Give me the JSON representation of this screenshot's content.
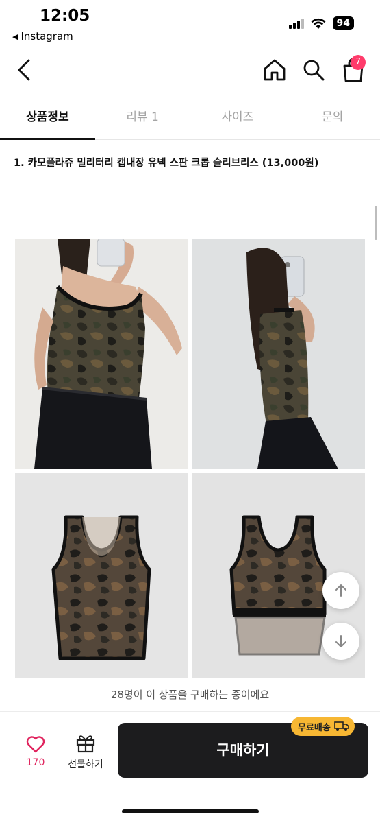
{
  "status_bar": {
    "time": "12:05",
    "back_app": "Instagram",
    "battery": "94"
  },
  "nav": {
    "cart_count": "7"
  },
  "tabs": [
    {
      "label": "상품정보",
      "active": true
    },
    {
      "label": "리뷰 1",
      "active": false
    },
    {
      "label": "사이즈",
      "active": false
    },
    {
      "label": "문의",
      "active": false
    }
  ],
  "product": {
    "title": "1. 카모플라쥬 밀리터리 캡내장 유넥 스판 크롭 슬리브리스 (13,000원)"
  },
  "viewers_text": "28명이 이 상품을 구매하는 중이에요",
  "bottom_bar": {
    "like_count": "170",
    "gift_label": "선물하기",
    "buy_label": "구매하기",
    "free_shipping_badge": "무료배송"
  },
  "colors": {
    "buy_button": "#1c1c1e",
    "like_accent": "#e0245e",
    "badge": "#ff3b6b",
    "free_ship": "#f7b733"
  }
}
